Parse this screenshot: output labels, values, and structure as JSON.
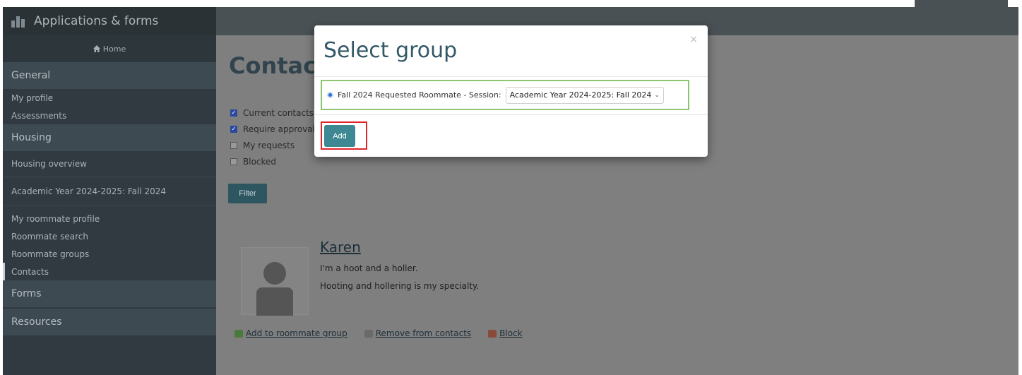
{
  "app": {
    "title": "Applications & forms",
    "home_label": "Home"
  },
  "sidebar": {
    "sections": {
      "general": "General",
      "housing": "Housing",
      "forms": "Forms",
      "resources": "Resources"
    },
    "general_items": [
      "My profile",
      "Assessments"
    ],
    "housing_items": {
      "overview": "Housing overview",
      "session": "Academic Year 2024-2025: Fall 2024",
      "roommate_profile": "My roommate profile",
      "roommate_search": "Roommate search",
      "roommate_groups": "Roommate groups",
      "contacts": "Contacts"
    }
  },
  "main": {
    "page_title": "Contact",
    "filters": [
      {
        "label": "Current contacts",
        "checked": true
      },
      {
        "label": "Require approval",
        "checked": true
      },
      {
        "label": "My requests",
        "checked": false
      },
      {
        "label": "Blocked",
        "checked": false
      }
    ],
    "filter_button": "Filter",
    "contact": {
      "name": "Karen",
      "line1": "I'm a hoot and a holler.",
      "line2": "Hooting and hollering is my specialty."
    },
    "actions": {
      "add_to_group": "Add to roommate group",
      "remove": "Remove from contacts",
      "block": "Block"
    }
  },
  "modal": {
    "title": "Select group",
    "close": "×",
    "option_label": "Fall 2024 Requested Roommate - Session:",
    "session_value": "Academic Year 2024-2025: Fall 2024",
    "add_button": "Add"
  },
  "colors": {
    "sidebar_bg": "#303a40",
    "overlay_bg": "#7f7f7f",
    "accent_button": "#3d8893",
    "highlight_green": "#8cc46f",
    "highlight_red": "#e0242c"
  }
}
